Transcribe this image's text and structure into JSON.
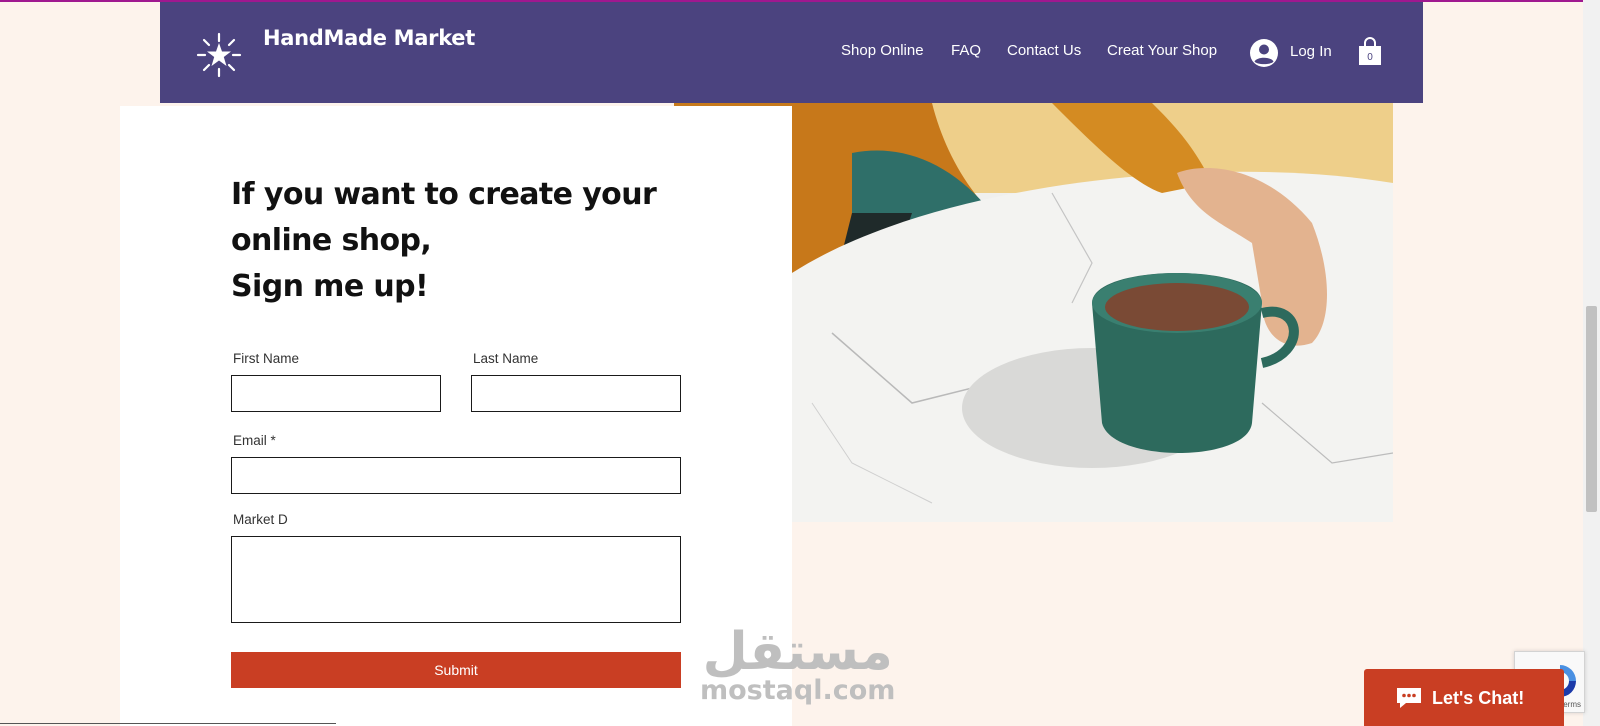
{
  "header": {
    "brand": "HandMade Market",
    "nav": [
      {
        "label": "Shop Online"
      },
      {
        "label": "FAQ"
      },
      {
        "label": "Contact Us"
      },
      {
        "label": "Creat Your Shop"
      }
    ],
    "login_label": "Log In",
    "cart_count": "0",
    "icons": {
      "logo": "sparkle-star-icon",
      "login": "user-circle-icon",
      "cart": "shopping-bag-icon"
    }
  },
  "form": {
    "heading_lines": [
      "If you want to create your",
      "online shop,",
      "Sign me up!"
    ],
    "first_name_label": "First Name",
    "last_name_label": "Last Name",
    "email_label": "Email *",
    "market_label": "Market D",
    "first_name_value": "",
    "last_name_value": "",
    "email_value": "",
    "market_value": "",
    "submit_label": "Submit"
  },
  "watermark": {
    "arabic": "مستقل",
    "latin": "mostaql.com"
  },
  "chat": {
    "label": "Let's Chat!"
  },
  "recaptcha": {
    "text": "Terms"
  },
  "colors": {
    "header_bg": "#4b437f",
    "page_bg": "#fdf3ec",
    "accent": "#c93e23",
    "top_line": "#a0188f"
  }
}
